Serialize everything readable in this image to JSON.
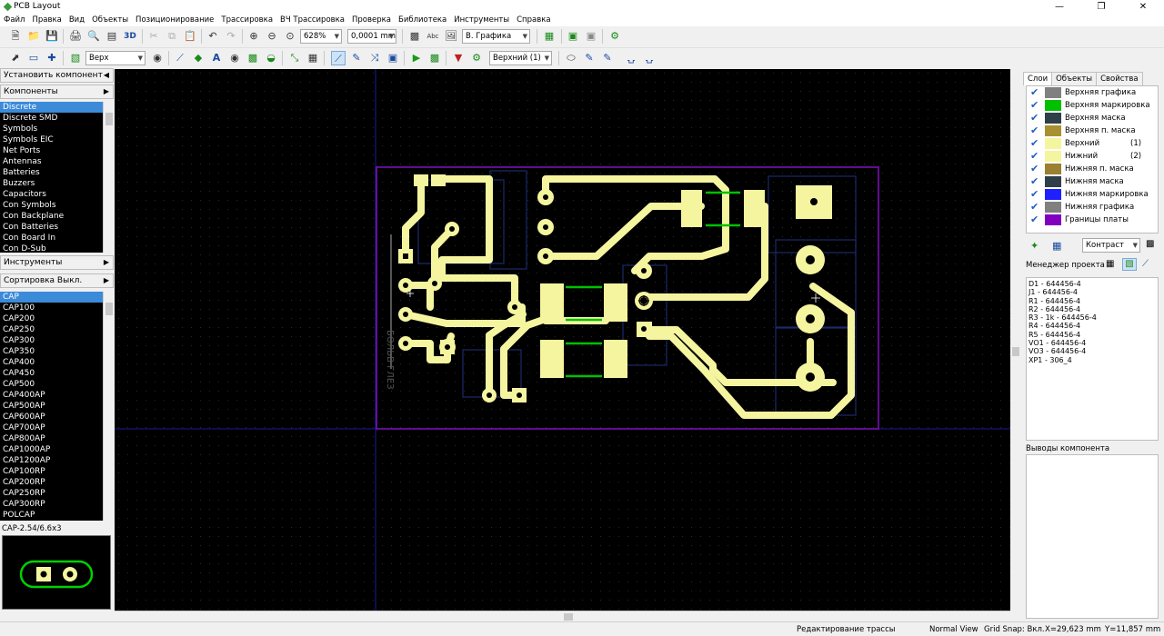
{
  "window": {
    "title": "PCB Layout"
  },
  "menu": [
    "Файл",
    "Правка",
    "Вид",
    "Объекты",
    "Позиционирование",
    "Трассировка",
    "ВЧ Трассировка",
    "Проверка",
    "Библиотека",
    "Инструменты",
    "Справка"
  ],
  "toolbar": {
    "btn_3d": "3D",
    "zoom": "628%",
    "grid": "0,0001 mm",
    "layer_graphics": "В. Графика",
    "side": "Верх",
    "layer_select": "Верхний (1)"
  },
  "left": {
    "install_component": "Установить компонент",
    "components_header": "Компоненты",
    "categories": [
      "Discrete",
      "Discrete SMD",
      "Symbols",
      "Symbols EIC",
      "Net Ports",
      "Antennas",
      "Batteries",
      "Buzzers",
      "Capacitors",
      "Con Symbols",
      "Con Backplane",
      "Con Batteries",
      "Con Board In",
      "Con D-Sub"
    ],
    "tools_header": "Инструменты",
    "sort_header": "Сортировка Выкл.",
    "parts": [
      "CAP",
      "CAP100",
      "CAP200",
      "CAP250",
      "CAP300",
      "CAP350",
      "CAP400",
      "CAP450",
      "CAP500",
      "CAP400AP",
      "CAP500AP",
      "CAP600AP",
      "CAP700AP",
      "CAP800AP",
      "CAP1000AP",
      "CAP1200AP",
      "CAP100RP",
      "CAP200RP",
      "CAP250RP",
      "CAP300RP",
      "POLCAP"
    ],
    "preview_label": "CAP-2.54/6.6x3"
  },
  "right": {
    "tabs": [
      "Слои",
      "Объекты",
      "Свойства"
    ],
    "layers": [
      {
        "name": "Верхняя графика",
        "color": "#808080",
        "num": ""
      },
      {
        "name": "Верхняя маркировка",
        "color": "#00c000",
        "num": ""
      },
      {
        "name": "Верхняя маска",
        "color": "#2e3f4a",
        "num": ""
      },
      {
        "name": "Верхняя п. маска",
        "color": "#a89030",
        "num": ""
      },
      {
        "name": "Верхний",
        "color": "#f5f5a0",
        "num": "(1)"
      },
      {
        "name": "Нижний",
        "color": "#f5f5a0",
        "num": "(2)"
      },
      {
        "name": "Нижняя п. маска",
        "color": "#9a8030",
        "num": ""
      },
      {
        "name": "Нижняя маска",
        "color": "#2e3f4a",
        "num": ""
      },
      {
        "name": "Нижняя маркировка",
        "color": "#2020ff",
        "num": ""
      },
      {
        "name": "Нижняя графика",
        "color": "#808080",
        "num": ""
      },
      {
        "name": "Границы платы",
        "color": "#8000c0",
        "num": ""
      }
    ],
    "contrast": "Контраст",
    "manager_title": "Менеджер проекта",
    "manager_items": [
      "D1 - 644456-4",
      "J1 - 644456-4",
      "R1 - 644456-4",
      "R2 - 644456-4",
      "R3 - 1k - 644456-4",
      "R4 - 644456-4",
      "R5 - 644456-4",
      "VO1 - 644456-4",
      "VO3 - 644456-4",
      "XP1 - 306_4"
    ],
    "pins_title": "Выводы компонента"
  },
  "status": {
    "mode": "Редактирование трассы",
    "view": "Normal View",
    "snap": "Grid Snap: Вкл.",
    "x": "X=29,623 mm",
    "y": "Y=11,857 mm"
  },
  "pcb": {
    "silk_text": "БОЛЬВ ГЛЕЗ"
  }
}
